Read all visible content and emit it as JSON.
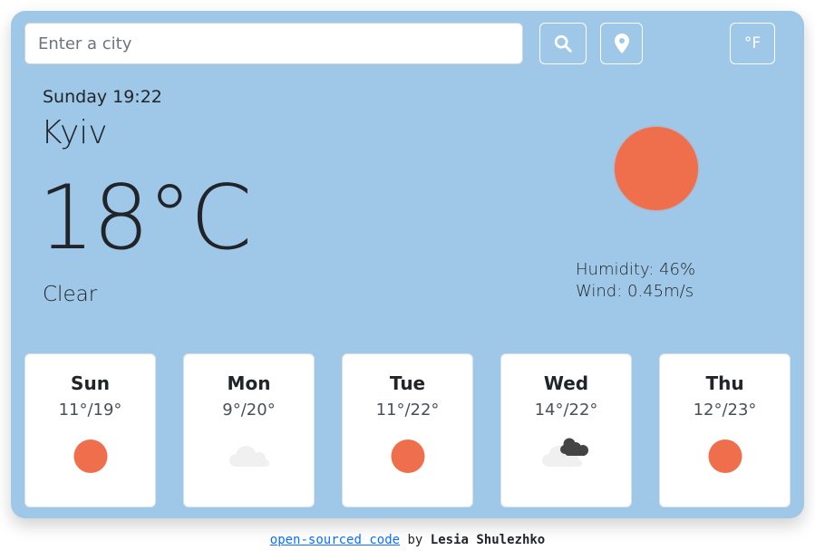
{
  "search": {
    "placeholder": "Enter a city"
  },
  "buttons": {
    "search_icon": "search-icon",
    "location_icon": "map-marker-icon",
    "unit_label": "°F"
  },
  "current": {
    "date": "Sunday 19:22",
    "city": "Kyiv",
    "temperature": "18°C",
    "description": "Clear",
    "icon": "sun-icon",
    "humidity": "Humidity: 46%",
    "wind": "Wind: 0.45m/s"
  },
  "forecast": [
    {
      "day": "Sun",
      "temp": "11°/19°",
      "icon": "sun-icon"
    },
    {
      "day": "Mon",
      "temp": "9°/20°",
      "icon": "cloud-icon"
    },
    {
      "day": "Tue",
      "temp": "11°/22°",
      "icon": "sun-icon"
    },
    {
      "day": "Wed",
      "temp": "14°/22°",
      "icon": "dark-clouds-icon"
    },
    {
      "day": "Thu",
      "temp": "12°/23°",
      "icon": "sun-icon"
    }
  ],
  "footer": {
    "link_text": "open-sourced code",
    "by_text": "by",
    "author": "Lesia Shulezhko"
  },
  "colors": {
    "card_background": "#9fc8e8",
    "sun": "#ef6e4c",
    "link": "#0d6efd"
  }
}
